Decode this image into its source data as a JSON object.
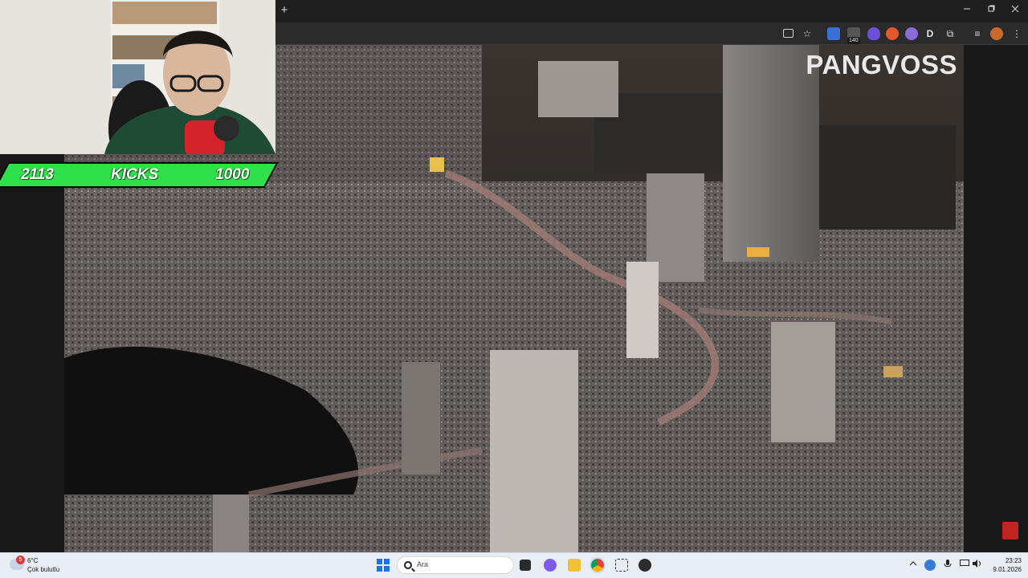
{
  "brand": {
    "logo_text": "PANGVOSS"
  },
  "overlay": {
    "left_count": "2113",
    "label": "KICKS",
    "right_count": "1000",
    "accent": "#2ee04a"
  },
  "browser": {
    "new_tab": "+",
    "extension_badge": "140",
    "profile_letter": "D",
    "window_controls": [
      "minimize-icon",
      "restore-icon",
      "close-icon"
    ]
  },
  "taskbar": {
    "weather_temp": "6°C",
    "weather_desc": "Çok bulutlu",
    "weather_badge": "5",
    "search_placeholder": "Ara",
    "clock_time": "23:23",
    "clock_date": "9.01.2026"
  }
}
